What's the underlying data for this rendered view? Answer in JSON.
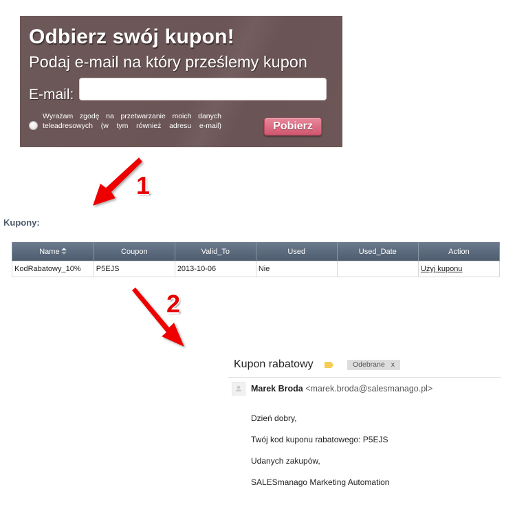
{
  "form": {
    "title": "Odbierz swój kupon!",
    "subtitle": "Podaj e-mail na który prześlemy kupon",
    "email_label": "E-mail:",
    "email_value": "",
    "consent_text": "Wyrażam zgodę na przetwarzanie moich danych teleadresowych (w tym również adresu e-mail)",
    "submit_label": "Pobierz",
    "background_color": "#6d5859",
    "button_color": "#d9657c"
  },
  "annotations": {
    "step1": "1",
    "step2": "2",
    "arrow_color": "#e60000"
  },
  "coupons": {
    "label": "Kupony:",
    "columns": [
      "Name",
      "Coupon",
      "Valid_To",
      "Used",
      "Used_Date",
      "Action"
    ],
    "rows": [
      {
        "name": "KodRabatowy_10%",
        "coupon": "P5EJS",
        "valid_to": "2013-10-06",
        "used": "Nie",
        "used_date": "",
        "action": "Użyj kuponu"
      }
    ],
    "header_color": "#5a697b"
  },
  "email": {
    "subject": "Kupon rabatowy",
    "tag": "Odebrane",
    "tag_remove": "x",
    "sender_name": "Marek Broda",
    "sender_email": "<marek.broda@salesmanago.pl>",
    "body": [
      "Dzień dobry,",
      "Twój kod kuponu rabatowego: P5EJS",
      "Udanych zakupów,",
      "SALESmanago Marketing Automation"
    ]
  }
}
